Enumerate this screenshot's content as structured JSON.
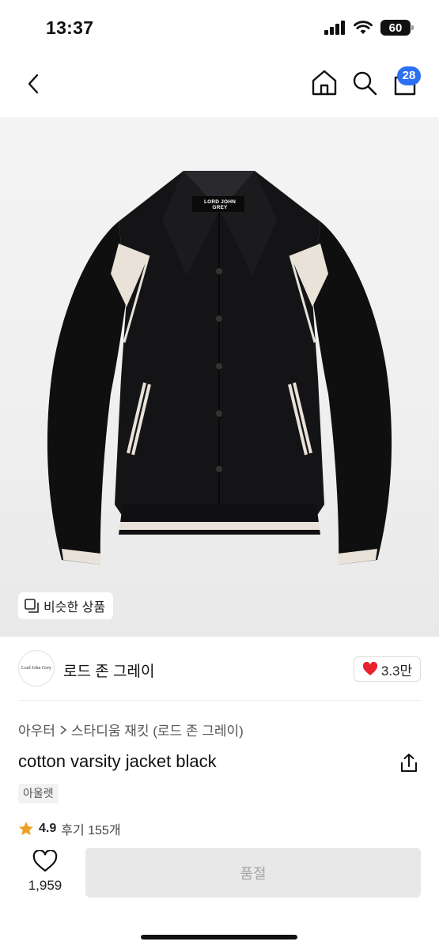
{
  "status": {
    "time": "13:37",
    "battery": "60"
  },
  "nav": {
    "cart_count": "28"
  },
  "image": {
    "label_text": "LORD JOHN GREY",
    "similar_button": "비슷한 상품"
  },
  "brand": {
    "logo_text": "Lord John Grey",
    "name": "로드 존 그레이",
    "likes": "3.3만"
  },
  "breadcrumb": {
    "category": "아우터",
    "subcategory": "스타디움 재킷 (로드 존 그레이)"
  },
  "product": {
    "title": "cotton varsity jacket black",
    "tag": "아울렛"
  },
  "rating": {
    "score": "4.9",
    "reviews": "후기 155개"
  },
  "bottom": {
    "wish_count": "1,959",
    "buy_label": "품절"
  },
  "colors": {
    "accent": "#2b6ff2",
    "heart": "#e8222f",
    "star": "#f0a020"
  }
}
